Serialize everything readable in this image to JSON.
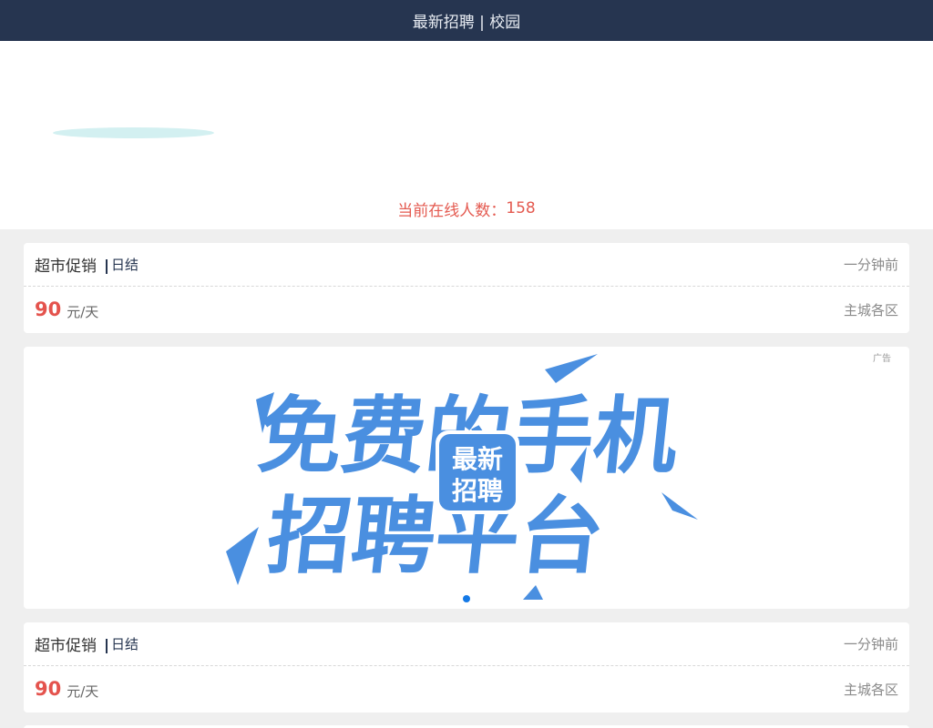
{
  "header": {
    "title": "最新招聘 | 校园"
  },
  "hero": {
    "online_label": "当前在线人数：",
    "online_count": "158"
  },
  "jobs": [
    {
      "title": "超市促销",
      "pay_type": "日结",
      "time": "一分钟前",
      "salary": "90",
      "unit": "元/天",
      "location": "主城各区"
    },
    {
      "title": "超市促销",
      "pay_type": "日结",
      "time": "一分钟前",
      "salary": "90",
      "unit": "元/天",
      "location": "主城各区"
    }
  ],
  "ad": {
    "label": "广告",
    "banner_text": [
      "免费的手机",
      "招聘平台"
    ],
    "badge_text": [
      "最新",
      "招聘"
    ],
    "colors": {
      "banner_blue": "#4a8fe0",
      "dot_active": "#1479e6"
    }
  },
  "colors": {
    "header_bg": "#263550",
    "accent_red": "#e4534d",
    "page_bg": "#efefef"
  }
}
